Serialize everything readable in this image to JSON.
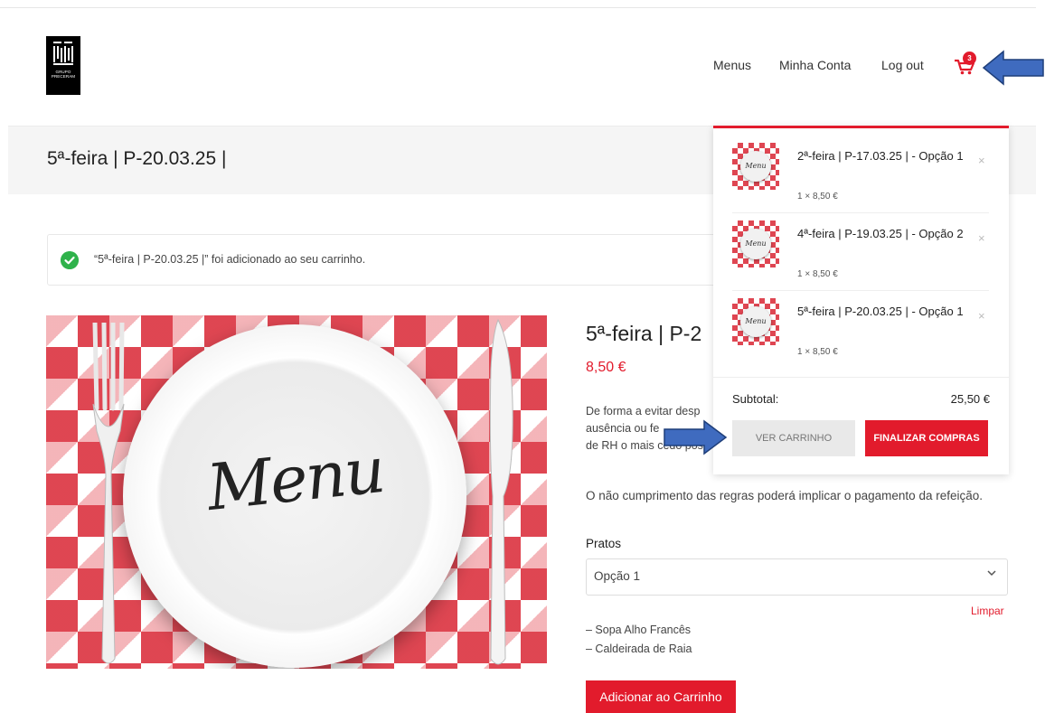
{
  "logo": {
    "line1": "GRUPO",
    "line2": "PRECERAM"
  },
  "nav": {
    "items": [
      "Menus",
      "Minha Conta",
      "Log out"
    ]
  },
  "cart": {
    "count": "3"
  },
  "page": {
    "title": "5ª-feira | P-20.03.25 |"
  },
  "notice": {
    "text": "“5ª-feira | P-20.03.25 |” foi adicionado ao seu carrinho."
  },
  "product": {
    "image_text": "Menu",
    "title": "5ª-feira | P-2",
    "price": "8,50 €",
    "desc_lines": [
      "De forma a evitar desp",
      "ausência ou fe",
      "de RH o mais cedo pos"
    ],
    "rule": "O não cumprimento das regras poderá implicar o pagamento da refeição.",
    "pratos_label": "Pratos",
    "select_value": "Opção 1",
    "limpar": "Limpar",
    "dishes": [
      "– Sopa Alho Francês",
      "– Caldeirada de Raia"
    ],
    "add_label": "Adicionar ao Carrinho"
  },
  "minicart": {
    "thumb_text": "Menu",
    "items": [
      {
        "name": "2ª-feira | P-17.03.25 | - Opção 1",
        "qty": "1 × 8,50 €"
      },
      {
        "name": "4ª-feira | P-19.03.25 | - Opção 2",
        "qty": "1 × 8,50 €"
      },
      {
        "name": "5ª-feira | P-20.03.25 | - Opção 1",
        "qty": "1 × 8,50 €"
      }
    ],
    "remove_symbol": "×",
    "subtotal_label": "Subtotal:",
    "subtotal_value": "25,50 €",
    "view_cart": "VER CARRINHO",
    "checkout": "FINALIZAR COMPRAS"
  },
  "colors": {
    "accent": "#e21b2c",
    "success": "#2fb24b",
    "annotation": "#3f6bbf"
  }
}
